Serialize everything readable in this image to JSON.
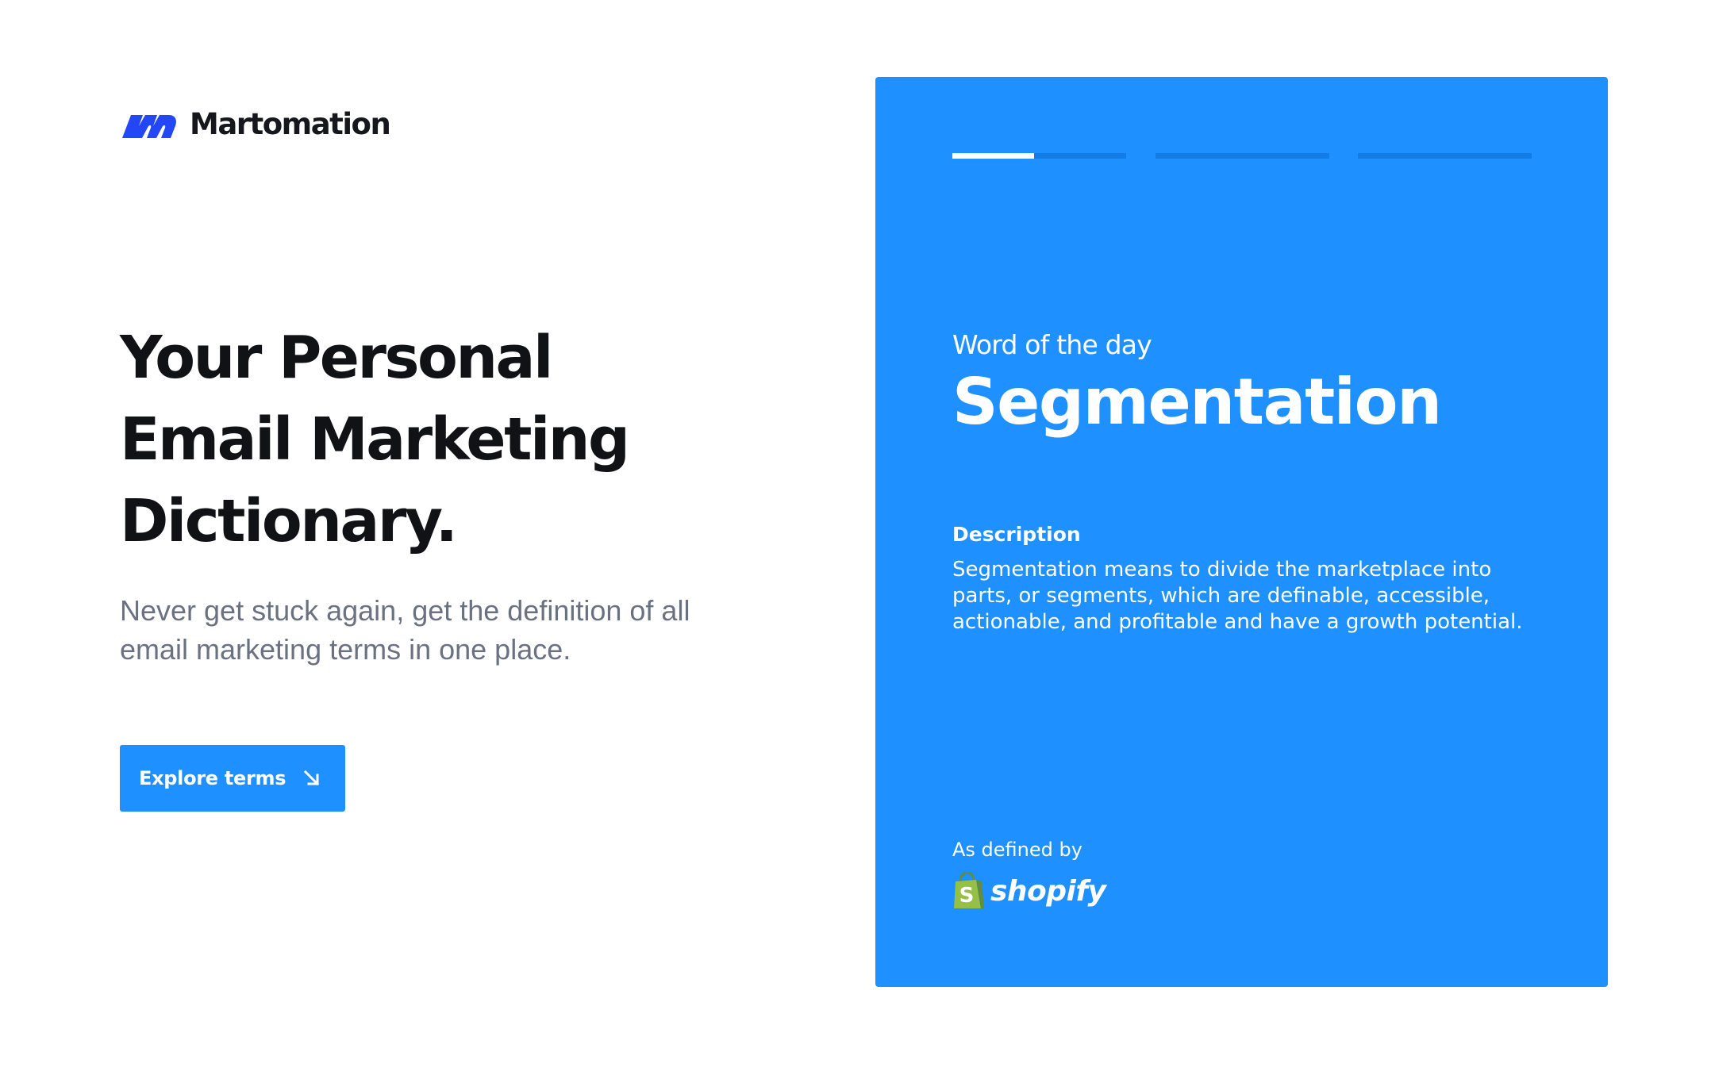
{
  "brand": {
    "name": "Martomation",
    "logo_color": "#2347f5"
  },
  "hero": {
    "headline_lines": [
      "Your Personal",
      "Email Marketing",
      "Dictionary."
    ],
    "subtext": "Never get stuck again, get the definition of all email marketing terms in one place.",
    "cta_label": "Explore terms",
    "cta_icon": "arrow-down-right-icon"
  },
  "word_card": {
    "progress": {
      "segments": 3,
      "active_index": 0,
      "active_fill": 0.47
    },
    "label": "Word of the day",
    "word": "Segmentation",
    "description_heading": "Description",
    "description": "Segmentation means to divide the marketplace into parts, or segments, which are definable, accessible, actionable, and profitable and have a growth potential.",
    "source_label": "As defined by",
    "source_name": "shopify",
    "source_icon": "shopify-bag-icon"
  },
  "colors": {
    "accent": "#1f90ff",
    "progress_track": "#137ce6",
    "headline": "#111216",
    "subtext": "#6a7180",
    "shopify_green": "#95bf47"
  }
}
